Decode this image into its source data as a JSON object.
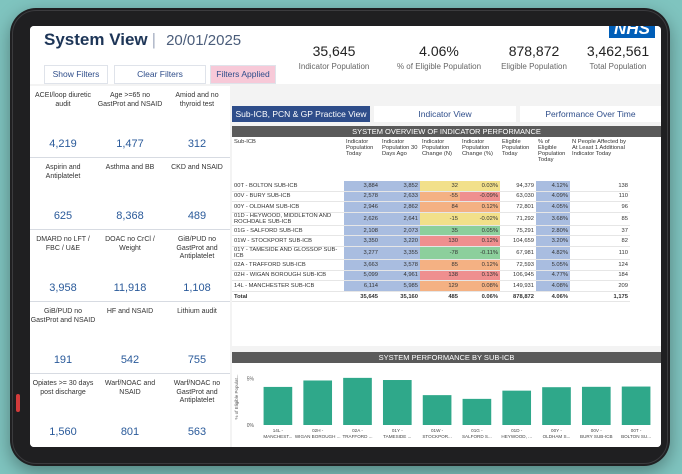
{
  "header": {
    "title": "System View",
    "separator": "|",
    "date": "20/01/2025",
    "logo": "NHS"
  },
  "filters": {
    "show": "Show Filters",
    "clear": "Clear Filters",
    "applied": "Filters Applied"
  },
  "kpis": [
    {
      "value": "35,645",
      "label": "Indicator Population"
    },
    {
      "value": "4.06%",
      "label": "% of Eligible Population"
    },
    {
      "value": "878,872",
      "label": "Eligible Population"
    },
    {
      "value": "3,462,561",
      "label": "Total Population"
    }
  ],
  "tiles": [
    {
      "title": "ACEI/loop diuretic audit",
      "value": "4,219"
    },
    {
      "title": "Age >=65 no GastProt and NSAID",
      "value": "1,477"
    },
    {
      "title": "Amiod and no thyroid test",
      "value": "312"
    },
    {
      "title": "Aspirin and Antiplatelet",
      "value": "625"
    },
    {
      "title": "Asthma and BB",
      "value": "8,368"
    },
    {
      "title": "CKD and NSAID",
      "value": "489"
    },
    {
      "title": "DMARD no LFT / FBC / U&E",
      "value": "3,958"
    },
    {
      "title": "DOAC no CrCl / Weight",
      "value": "11,918"
    },
    {
      "title": "GiB/PUD no GastProt and Antiplatelet",
      "value": "1,108"
    },
    {
      "title": "GiB/PUD no GastProt and NSAID",
      "value": "191"
    },
    {
      "title": "HF and NSAID",
      "value": "542"
    },
    {
      "title": "Lithium audit",
      "value": "755"
    },
    {
      "title": "Opiates >= 30 days post discharge",
      "value": "1,560"
    },
    {
      "title": "Warf/NOAC and NSAID",
      "value": "801"
    },
    {
      "title": "Warf/NOAC no GastProt and Antiplatelet",
      "value": "563"
    }
  ],
  "tabs": [
    {
      "label": "Sub-ICB, PCN & GP Practice View"
    },
    {
      "label": "Indicator View"
    },
    {
      "label": "Performance Over Time"
    }
  ],
  "table": {
    "title": "SYSTEM OVERVIEW OF INDICATOR PERFORMANCE",
    "headers": [
      "Sub-ICB",
      "Indicator Population Today",
      "Indicator Population 30 Days Ago",
      "Indicator Population Change (N)",
      "Indicator Population Change (%)",
      "Eligible Population Today",
      "% of Eligible Population Today",
      "N People Affected by At Least 1 Additional Indicator Today"
    ],
    "rows": [
      [
        "00T - BOLTON SUB-ICB",
        "3,884",
        "3,852",
        "32",
        "0.03%",
        "94,379",
        "4.12%",
        "138"
      ],
      [
        "00V - BURY SUB-ICB",
        "2,578",
        "2,633",
        "-55",
        "-0.09%",
        "63,030",
        "4.09%",
        "110"
      ],
      [
        "00Y - OLDHAM SUB-ICB",
        "2,946",
        "2,862",
        "84",
        "0.12%",
        "72,801",
        "4.05%",
        "96"
      ],
      [
        "01D - HEYWOOD, MIDDLETON AND ROCHDALE SUB-ICB",
        "2,626",
        "2,641",
        "-15",
        "-0.02%",
        "71,292",
        "3.68%",
        "85"
      ],
      [
        "01G - SALFORD SUB-ICB",
        "2,108",
        "2,073",
        "35",
        "0.05%",
        "75,291",
        "2.80%",
        "37"
      ],
      [
        "01W - STOCKPORT SUB-ICB",
        "3,350",
        "3,220",
        "130",
        "0.12%",
        "104,659",
        "3.20%",
        "82"
      ],
      [
        "01Y - TAMESIDE AND GLOSSOP SUB-ICB",
        "3,277",
        "3,355",
        "-78",
        "-0.11%",
        "67,981",
        "4.82%",
        "110"
      ],
      [
        "02A - TRAFFORD SUB-ICB",
        "3,663",
        "3,578",
        "85",
        "0.12%",
        "72,593",
        "5.05%",
        "124"
      ],
      [
        "02H - WIGAN BOROUGH SUB-ICB",
        "5,099",
        "4,961",
        "138",
        "0.13%",
        "106,945",
        "4.77%",
        "184"
      ],
      [
        "14L - MANCHESTER SUB-ICB",
        "6,114",
        "5,985",
        "129",
        "0.08%",
        "149,931",
        "4.08%",
        "209"
      ]
    ],
    "total": [
      "Total",
      "35,645",
      "35,160",
      "485",
      "0.06%",
      "878,872",
      "4.06%",
      "1,175"
    ]
  },
  "chart_data": {
    "type": "bar",
    "title": "SYSTEM PERFORMANCE BY SUB-ICB",
    "ylabel": "% of Eligible Populat...",
    "categories": [
      "14L - MANCHEST...",
      "02H - WIGAN BOROUGH ...",
      "02A - TRAFFORD ...",
      "01Y - TAMESIDE ...",
      "01W - STOCKPOR...",
      "01G - SALFORD S...",
      "01D - HEYWOOD, ...",
      "00Y - OLDHAM S...",
      "00V - BURY SUB-ICB",
      "00T - BOLTON SU..."
    ],
    "values": [
      4.08,
      4.77,
      5.05,
      4.82,
      3.2,
      2.8,
      3.68,
      4.05,
      4.09,
      4.12
    ],
    "yticks": [
      "5%",
      "0%"
    ],
    "ylim": [
      0,
      6
    ],
    "color": "#2fa88a"
  }
}
